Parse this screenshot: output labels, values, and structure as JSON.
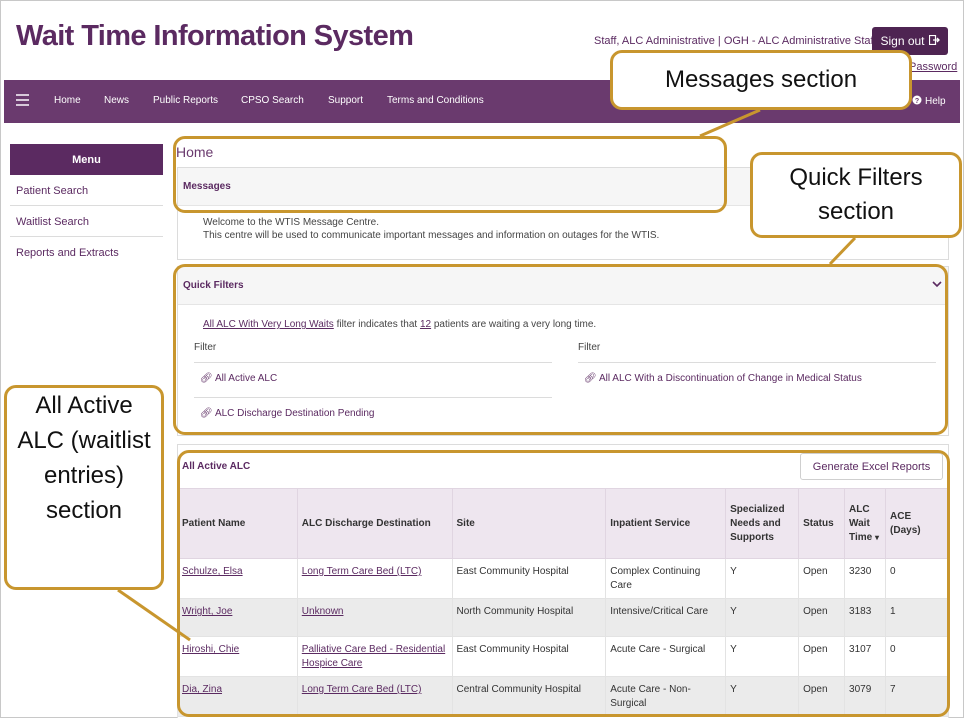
{
  "header": {
    "app_title": "Wait Time Information System",
    "user_info": "Staff, ALC Administrative | OGH - ALC Administrative Staff",
    "sign_out": "Sign out",
    "password_link": "Password"
  },
  "nav": {
    "items": [
      "Home",
      "News",
      "Public Reports",
      "CPSO Search",
      "Support",
      "Terms and Conditions"
    ],
    "help": "Help"
  },
  "sidebar": {
    "title": "Menu",
    "items": [
      "Patient Search",
      "Waitlist Search",
      "Reports and Extracts"
    ]
  },
  "breadcrumb": "Home",
  "messages": {
    "title": "Messages",
    "line1": "Welcome to the WTIS Message Centre.",
    "line2": "This centre will be used to communicate important messages and information on outages for the WTIS."
  },
  "quick_filters": {
    "title": "Quick Filters",
    "summary_link": "All ALC With Very Long Waits",
    "summary_mid": "filter indicates that",
    "summary_count": "12",
    "summary_end": "patients are waiting a very long time.",
    "filter_header": "Filter",
    "left_filters": [
      "All Active ALC",
      "ALC Discharge Destination Pending"
    ],
    "right_filters": [
      "All ALC With a Discontinuation of Change in Medical Status"
    ]
  },
  "all_active": {
    "title": "All Active ALC",
    "excel_button": "Generate Excel Reports",
    "columns": [
      "Patient Name",
      "ALC Discharge Destination",
      "Site",
      "Inpatient Service",
      "Specialized Needs and Supports",
      "Status",
      "ALC Wait Time",
      "ACE (Days)"
    ],
    "rows": [
      [
        "Schulze, Elsa",
        "Long Term Care Bed (LTC)",
        "East Community Hospital",
        "Complex Continuing Care",
        "Y",
        "Open",
        "3230",
        "0"
      ],
      [
        "Wright, Joe",
        "Unknown",
        "North Community Hospital",
        "Intensive/Critical Care",
        "Y",
        "Open",
        "3183",
        "1"
      ],
      [
        "Hiroshi, Chie",
        "Palliative Care Bed - Residential Hospice Care",
        "East Community Hospital",
        "Acute Care - Surgical",
        "Y",
        "Open",
        "3107",
        "0"
      ],
      [
        "Dia, Zina",
        "Long Term Care Bed (LTC)",
        "Central Community Hospital",
        "Acute Care - Non-Surgical",
        "Y",
        "Open",
        "3079",
        "7"
      ]
    ]
  },
  "callouts": {
    "messages": "Messages section",
    "quick_filters": "Quick Filters section",
    "all_active": "All Active ALC (waitlist entries) section"
  },
  "colors": {
    "brand_purple": "#5b2a61",
    "nav_purple": "#6a3a6e",
    "callout_gold": "#c8962e"
  }
}
